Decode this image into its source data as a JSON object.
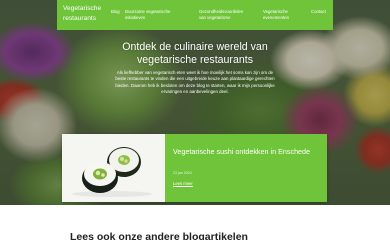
{
  "nav": {
    "brand": "Vegetarische restaurants",
    "items": [
      {
        "label": "Blog"
      },
      {
        "label": "Duurzame vegetarische initiatieven"
      },
      {
        "label": "Gezondheidsvoordelen van vegetarisme"
      },
      {
        "label": "Vegetarische evenementen"
      },
      {
        "label": "Contact"
      }
    ]
  },
  "hero": {
    "title": "Ontdek de culinaire wereld van vegetarische restaurants",
    "body": "Als liefhebber van vegetarisch eten weet ik hoe moeilijk het soms kan zijn om de beste restaurants te vinden die een uitgebreide keuze aan plantaardige gerechten bieden. Daarom heb ik besloten om deze blog te starten, waar ik mijn persoonlijke ervaringen en aanbevelingen deel."
  },
  "featured": {
    "title": "Vegetarische sushi ontdekken in Enschede",
    "date": "23 jan 2024",
    "link_label": "Lees meer",
    "image_icon": "sushi-image"
  },
  "more": {
    "heading": "Lees ook onze andere blogartikelen"
  },
  "colors": {
    "accent": "#6fc43a",
    "text_dark": "#222222"
  }
}
